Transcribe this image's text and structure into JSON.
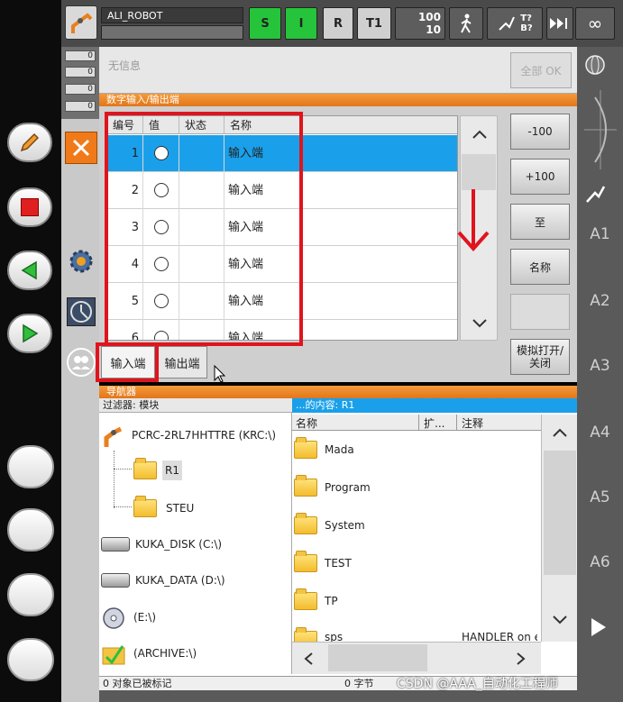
{
  "header": {
    "robot_name": "ALI_ROBOT",
    "btn_s": "S",
    "btn_i": "I",
    "btn_r": "R",
    "btn_t1": "T1",
    "override_top": "100",
    "override_bottom": "10",
    "tb_label": "T?\nB?",
    "infinity": "∞"
  },
  "messages": {
    "counts": [
      "0",
      "0",
      "0",
      "0"
    ],
    "text": "无信息",
    "all_ok": "全部 OK"
  },
  "io": {
    "title": "数字输入/输出端",
    "columns": [
      "编号",
      "值",
      "状态",
      "名称"
    ],
    "rows": [
      {
        "num": "1",
        "name": "输入端"
      },
      {
        "num": "2",
        "name": "输入端"
      },
      {
        "num": "3",
        "name": "输入端"
      },
      {
        "num": "4",
        "name": "输入端"
      },
      {
        "num": "5",
        "name": "输入端"
      },
      {
        "num": "6",
        "name": "输入端"
      }
    ],
    "side_buttons": [
      "-100",
      "+100",
      "至",
      "名称",
      "",
      "模拟打开/\n关闭"
    ],
    "tab_input": "输入端",
    "tab_output": "输出端"
  },
  "navigator": {
    "title": "导航器",
    "filter": "过滤器: 模块",
    "content_header": "...的内容: R1",
    "tree": [
      {
        "label": "PCRC-2RL7HHTTRE (KRC:\\)",
        "icon": "robot-icon"
      },
      {
        "label": "R1",
        "icon": "folder-icon"
      },
      {
        "label": "STEU",
        "icon": "folder-icon"
      },
      {
        "label": "KUKA_DISK (C:\\)",
        "icon": "disk-icon"
      },
      {
        "label": "KUKA_DATA (D:\\)",
        "icon": "disk-icon"
      },
      {
        "label": "(E:\\)",
        "icon": "cd-icon"
      },
      {
        "label": "(ARCHIVE:\\)",
        "icon": "archive-icon"
      }
    ],
    "list_columns": [
      "名称",
      "扩...",
      "注释"
    ],
    "list": [
      "Mada",
      "Program",
      "System",
      "TEST",
      "TP",
      "sps"
    ],
    "list_last_comment": "HANDLER on ex",
    "status_left": "0 对象已被标记",
    "status_right": "0 字节"
  },
  "axes": [
    "A1",
    "A2",
    "A3",
    "A4",
    "A5",
    "A6"
  ],
  "watermark": "CSDN @AAA_自动化工程师",
  "colors": {
    "orange": "#e8801f",
    "select_blue": "#1aa0ea",
    "green": "#25c43a",
    "red_box": "#e0141d"
  }
}
